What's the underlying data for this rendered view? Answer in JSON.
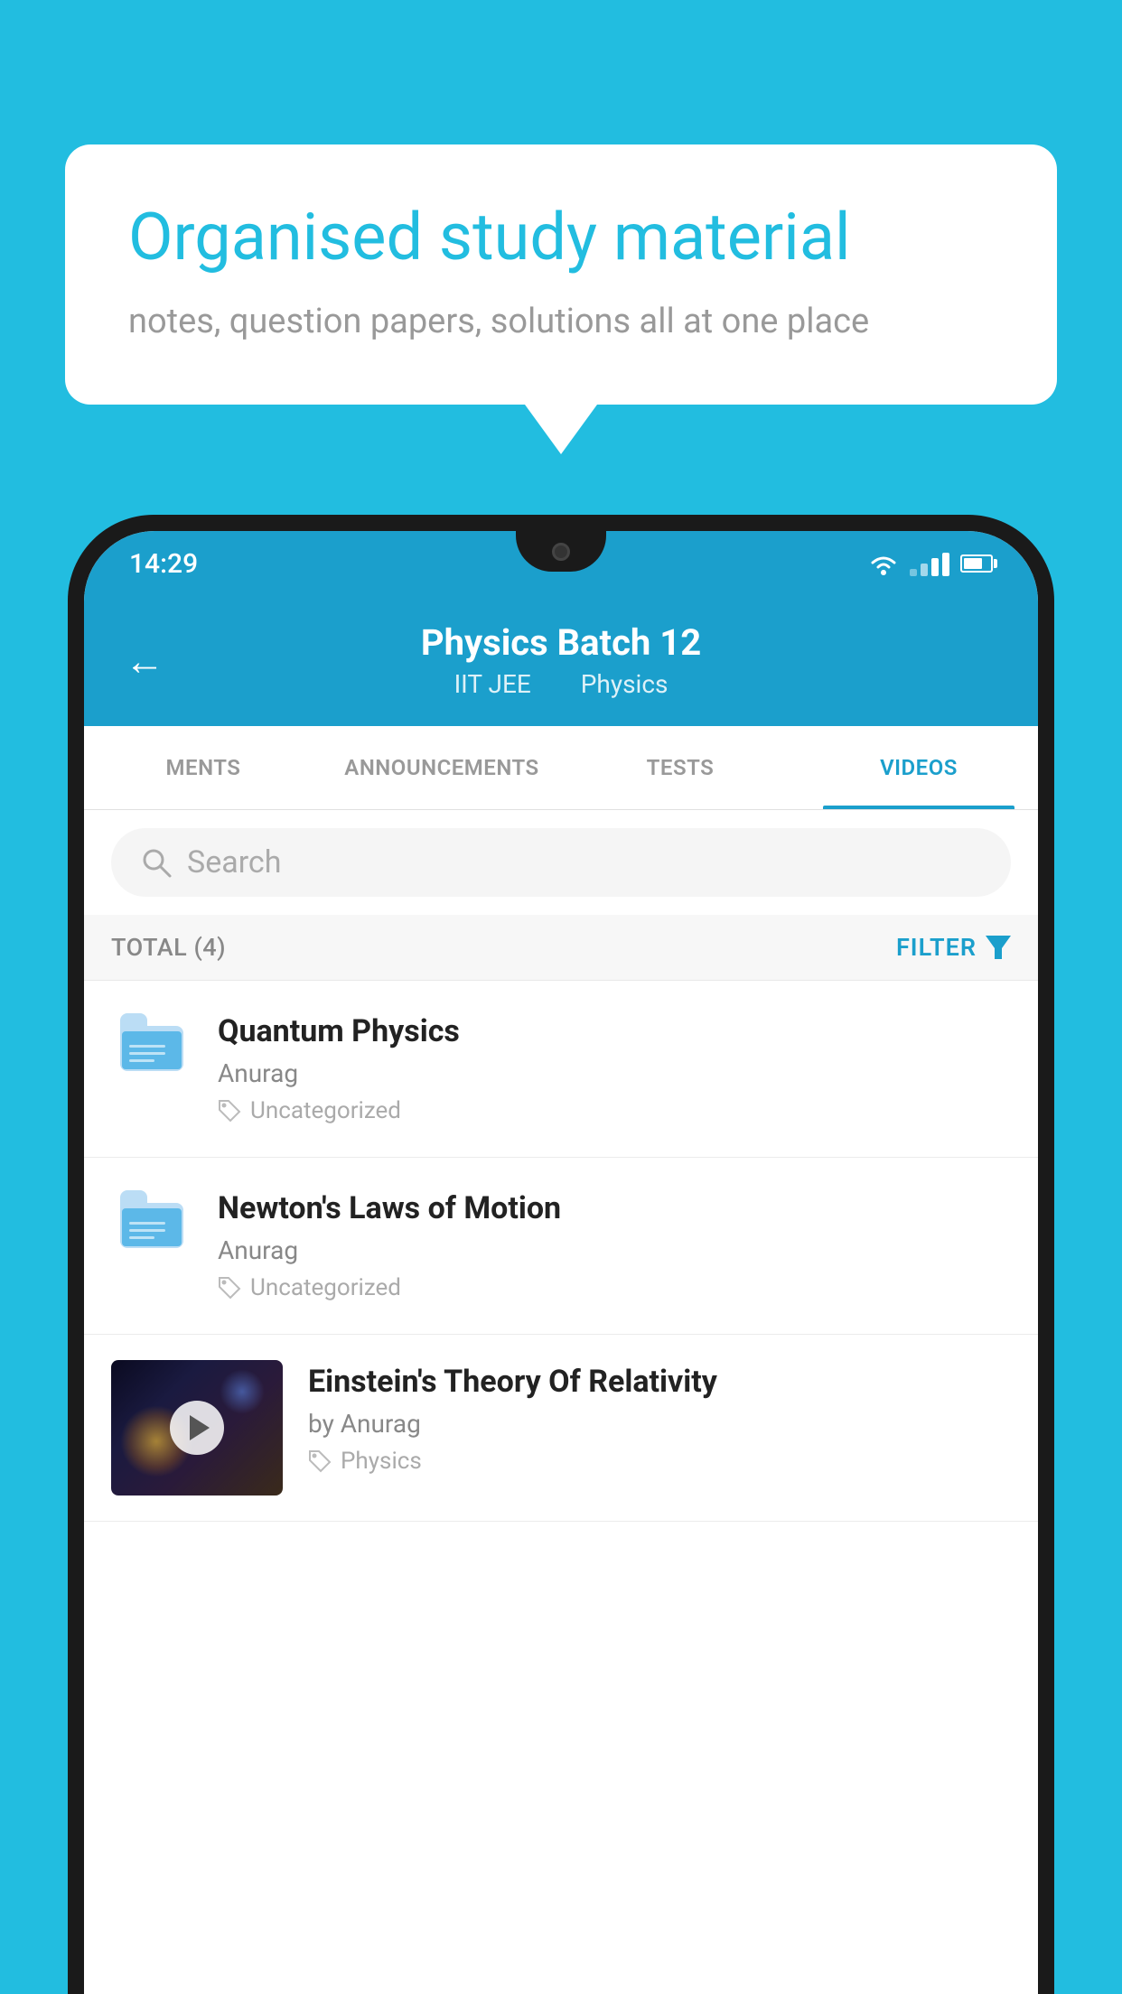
{
  "background": {
    "color": "#22bde0"
  },
  "speech_bubble": {
    "title": "Organised study material",
    "subtitle": "notes, question papers, solutions all at one place"
  },
  "status_bar": {
    "time": "14:29"
  },
  "app_header": {
    "title": "Physics Batch 12",
    "subtitle_part1": "IIT JEE",
    "subtitle_part2": "Physics",
    "back_label": "←"
  },
  "tabs": [
    {
      "label": "MENTS",
      "active": false
    },
    {
      "label": "ANNOUNCEMENTS",
      "active": false
    },
    {
      "label": "TESTS",
      "active": false
    },
    {
      "label": "VIDEOS",
      "active": true
    }
  ],
  "search": {
    "placeholder": "Search"
  },
  "filter_bar": {
    "total_label": "TOTAL (4)",
    "filter_label": "FILTER"
  },
  "videos": [
    {
      "title": "Quantum Physics",
      "author": "Anurag",
      "tag": "Uncategorized",
      "has_thumb": false
    },
    {
      "title": "Newton's Laws of Motion",
      "author": "Anurag",
      "tag": "Uncategorized",
      "has_thumb": false
    },
    {
      "title": "Einstein's Theory Of Relativity",
      "author": "by Anurag",
      "tag": "Physics",
      "has_thumb": true
    }
  ]
}
